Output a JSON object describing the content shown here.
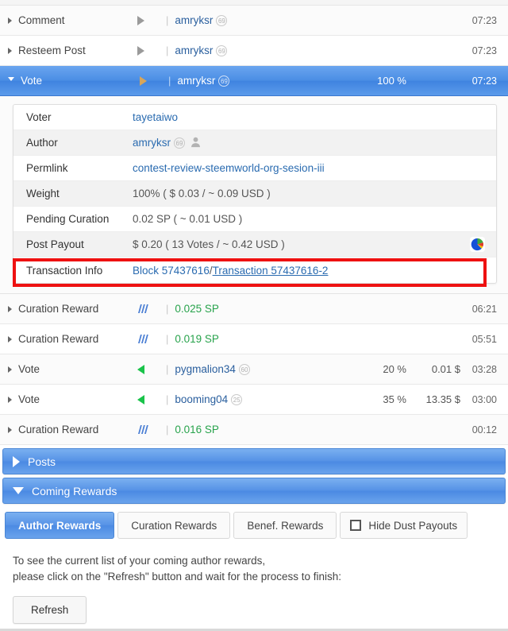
{
  "activity_rows": [
    {
      "type": "Comment",
      "icon": "triangle-right-gray-icon",
      "user": "amryksr",
      "reputation": "69",
      "percent": "",
      "amount": "",
      "time": "07:23",
      "selected": false,
      "expanded": false
    },
    {
      "type": "Resteem Post",
      "icon": "triangle-right-gray-icon",
      "user": "amryksr",
      "reputation": "69",
      "percent": "",
      "amount": "",
      "time": "07:23",
      "selected": false,
      "expanded": false
    },
    {
      "type": "Vote",
      "icon": "triangle-right-gray-icon",
      "user": "amryksr",
      "reputation": "69",
      "percent": "100 %",
      "amount": "",
      "time": "07:23",
      "selected": true,
      "expanded": true
    }
  ],
  "detail": {
    "rows": [
      {
        "label": "Voter",
        "value": "tayetaiwo",
        "style": "link"
      },
      {
        "label": "Author",
        "value": "amryksr",
        "style": "link",
        "reputation": "69",
        "avatar": true
      },
      {
        "label": "Permlink",
        "value": "contest-review-steemworld-org-sesion-iii",
        "style": "link"
      },
      {
        "label": "Weight",
        "value": "100% ( $ 0.03 / ~ 0.09 USD )",
        "style": "plain"
      },
      {
        "label": "Pending Curation",
        "value": "0.02 SP ( ~ 0.01 USD )",
        "style": "plain"
      },
      {
        "label": "Post Payout",
        "value": "$ 0.20 ( 13 Votes / ~ 0.42 USD )",
        "style": "plain",
        "pie_chart": true
      }
    ],
    "transaction_info": {
      "label": "Transaction Info",
      "block_text": "Block 57437616",
      "separator": " / ",
      "transaction_text": "Transaction 57437616-2"
    },
    "highlight_color": "#ee1111"
  },
  "activity_rows_after": [
    {
      "type": "Curation Reward",
      "icon": "steem-logo-icon",
      "value": "0.025 SP",
      "value_color": "#28a34c",
      "percent": "",
      "amount": "",
      "time": "06:21"
    },
    {
      "type": "Curation Reward",
      "icon": "steem-logo-icon",
      "value": "0.019 SP",
      "value_color": "#28a34c",
      "percent": "",
      "amount": "",
      "time": "05:51"
    },
    {
      "type": "Vote",
      "icon": "triangle-left-green-icon",
      "user": "pygmalion34",
      "reputation": "60",
      "percent": "20 %",
      "amount": "0.01 $",
      "time": "03:28"
    },
    {
      "type": "Vote",
      "icon": "triangle-left-green-icon",
      "user": "booming04",
      "reputation": "25",
      "percent": "35 %",
      "amount": "13.35 $",
      "time": "03:00"
    },
    {
      "type": "Curation Reward",
      "icon": "steem-logo-icon",
      "value": "0.016 SP",
      "value_color": "#28a34c",
      "percent": "",
      "amount": "",
      "time": "00:12"
    }
  ],
  "sections": [
    {
      "title": "Posts",
      "expanded": false
    },
    {
      "title": "Coming Rewards",
      "expanded": true
    }
  ],
  "tabs": [
    {
      "label": "Author Rewards",
      "active": true,
      "checkbox": false
    },
    {
      "label": "Curation Rewards",
      "active": false,
      "checkbox": false
    },
    {
      "label": "Benef. Rewards",
      "active": false,
      "checkbox": false
    },
    {
      "label": "Hide Dust Payouts",
      "active": false,
      "checkbox": true,
      "checked": false
    }
  ],
  "info": {
    "line1": "To see the current list of your coming author rewards,",
    "line2": "please click on the \"Refresh\" button and wait for the process to finish:"
  },
  "refresh_button": {
    "label": "Refresh"
  },
  "colors": {
    "accent_blue": "#4b8ae3",
    "link_blue": "#2a6bb0",
    "green": "#28a34c",
    "highlight_red": "#ee1111"
  }
}
